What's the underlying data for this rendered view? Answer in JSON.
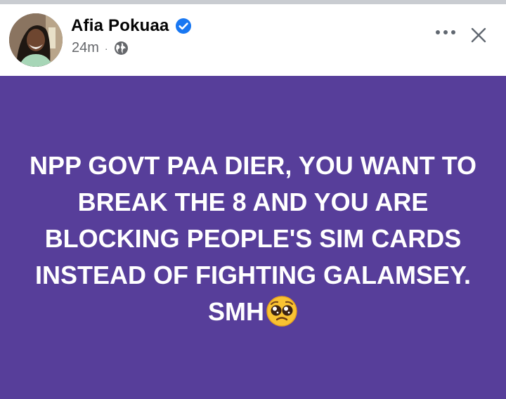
{
  "colors": {
    "post_background": "#573e9a",
    "verified_badge": "#1877f2",
    "post_text": "#ffffff",
    "name_text": "#050505",
    "meta_text": "#65676b"
  },
  "author": {
    "name": "Afia Pokuaa",
    "verified": true,
    "avatar_icon": "profile-photo"
  },
  "meta": {
    "time": "24m",
    "separator": "·",
    "audience_icon": "globe-icon"
  },
  "actions": {
    "more_icon": "more-horizontal-icon",
    "close_icon": "close-icon"
  },
  "post": {
    "lines": [
      "NPP GOVT PAA DIER, YOU WANT TO",
      "BREAK THE 8 AND YOU ARE",
      "BLOCKING PEOPLE'S SIM CARDS",
      "INSTEAD OF FIGHTING GALAMSEY.",
      "SMH"
    ],
    "trailing_emoji": "pleading-face-emoji"
  }
}
